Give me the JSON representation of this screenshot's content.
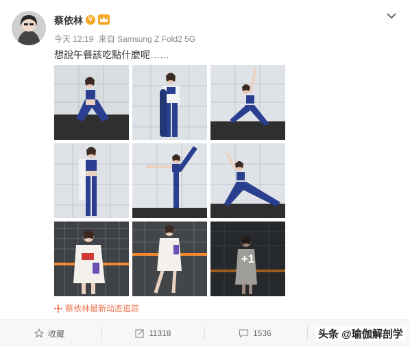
{
  "author": {
    "name": "蔡依林",
    "verified_badge": "V"
  },
  "post_meta": {
    "time": "今天 12:19",
    "source": "来自 Samsung Z Fold2 5G"
  },
  "post_text": "想說午餐該吃點什麼呢……",
  "gallery": {
    "more_label": "+1",
    "images": [
      "yoga-photo",
      "yoga-photo",
      "yoga-photo",
      "yoga-photo",
      "yoga-photo",
      "yoga-photo",
      "fashion-photo",
      "fashion-photo",
      "fashion-photo"
    ]
  },
  "tracker_link": "蔡依林最新动态追踪",
  "actions": {
    "favorite_label": "收藏",
    "repost_count": "11318",
    "comment_count": "1536"
  },
  "watermark": "头条 @瑜伽解剖学",
  "colors": {
    "accent": "#eb7350",
    "badge": "#f5a623",
    "yoga_blue": "#2a3f8f"
  }
}
